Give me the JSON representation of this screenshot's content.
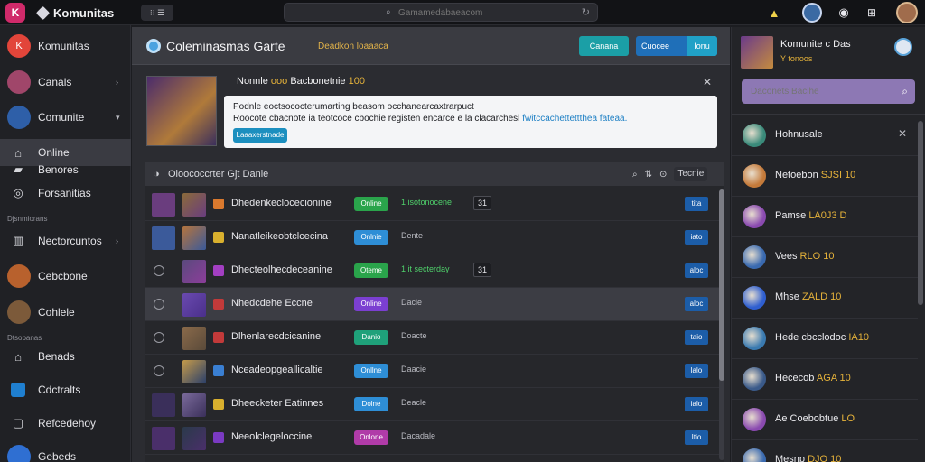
{
  "topbar": {
    "app_logo": "K",
    "brand": "Komunitas",
    "pill_label": "⁝⁝ ☰",
    "search_placeholder": "Gamamedabaeacom",
    "icons": [
      "search-icon",
      "refresh-icon",
      "bell-icon",
      "user-avatar",
      "notification-icon",
      "gamepad-icon",
      "profile-avatar"
    ]
  },
  "sidebar": {
    "items": [
      {
        "label": "Komunitas",
        "icon": "K"
      },
      {
        "label": "Canals",
        "chev": "›"
      },
      {
        "label": "Comunite",
        "chev": "▾"
      },
      {
        "label": "Online"
      },
      {
        "label": "Benores"
      },
      {
        "label": "Forsanitias"
      },
      {
        "label": "Nectorcuntos",
        "chev": "›"
      },
      {
        "label": "Cebcbone"
      },
      {
        "label": "Cohlele"
      },
      {
        "label": "Benads"
      },
      {
        "label": "Cdctralts"
      },
      {
        "label": "Refcedehoy"
      },
      {
        "label": "Gebeds"
      }
    ],
    "sections": [
      "Djsnmiorans",
      "Dtsobanas"
    ]
  },
  "main": {
    "title": "Coleminasmas Garte",
    "subtitle": "Deadkon loaaaca",
    "btn_primary": "Canana",
    "btn_secondary": "Cuocee",
    "btn_secondary_seg": "Ionu",
    "feature": {
      "title": "Nonnle",
      "tag": "ooo",
      "title_rest": "Bacbonetnie",
      "title_tag2": "100",
      "line1": "Podnle eoctsococterumarting beasom occhanearcaxtrarpuct",
      "line2": "Roocote cbacnote ia teotcoce cbochie registen encarce e la clacarchesl",
      "line2_link": "fwitccachettettthea fateaa.",
      "button": "Laaaxerstnade"
    },
    "table": {
      "title": "Oloococcrter Gjt Danie",
      "tool_btn": "Tecnie",
      "rows": [
        {
          "name": "Dhedenkeclocecionine",
          "status": "Online",
          "status_color": "#2aa44b",
          "score": "1 isotonocene",
          "score_green": true,
          "rank": "31",
          "code": "tita"
        },
        {
          "name": "Nanatleikeobtclcecina",
          "status": "Onlnie",
          "status_color": "#2e8ed6",
          "score": "Dente",
          "score_green": false,
          "rank": "",
          "code": "iato"
        },
        {
          "name": "Dhecteolhecdeceanine",
          "status": "Oteme",
          "status_color": "#2aa44b",
          "score": "1 it secterday",
          "score_green": true,
          "rank": "31",
          "code": "aloc"
        },
        {
          "name": "Nhedcdehe Eccne",
          "status": "Online",
          "status_color": "#7b3fd1",
          "score": "Dacie",
          "score_green": false,
          "rank": "",
          "code": "aloc"
        },
        {
          "name": "Dlhenlarecdcicanine",
          "status": "Danio",
          "status_color": "#1fa17a",
          "score": "Doacte",
          "score_green": false,
          "rank": "",
          "code": "taio"
        },
        {
          "name": "Nceadeopgeallicaltie",
          "status": "Onllne",
          "status_color": "#2e8ed6",
          "score": "Daacie",
          "score_green": false,
          "rank": "",
          "code": "lalo"
        },
        {
          "name": "Dheecketer Eatinnes",
          "status": "Dolne",
          "status_color": "#2e8ed6",
          "score": "Deacle",
          "score_green": false,
          "rank": "",
          "code": "ialo"
        },
        {
          "name": "Neeolclegeloccine",
          "status": "Onlone",
          "status_color": "#b03ba8",
          "score": "Dacadale",
          "score_green": false,
          "rank": "",
          "code": "Itio"
        }
      ]
    }
  },
  "right": {
    "name": "Komunite c Das",
    "sub": "Y tonoos",
    "search_placeholder": "Daconets Bacihe",
    "items": [
      {
        "name": "Hohnusale",
        "tag": ""
      },
      {
        "name": "Netoebon",
        "tag": "SJSI 10"
      },
      {
        "name": "Pamse",
        "tag": "LA0J3 D"
      },
      {
        "name": "Vees",
        "tag": "RLO 10"
      },
      {
        "name": "Mhse",
        "tag": "ZALD 10"
      },
      {
        "name": "Hede cbcclodoc",
        "tag": "IA10"
      },
      {
        "name": "Hececob",
        "tag": "AGA 10"
      },
      {
        "name": "Ae Coebobtue",
        "tag": "LO"
      },
      {
        "name": "Mesnp",
        "tag": "DJO 10"
      }
    ]
  }
}
